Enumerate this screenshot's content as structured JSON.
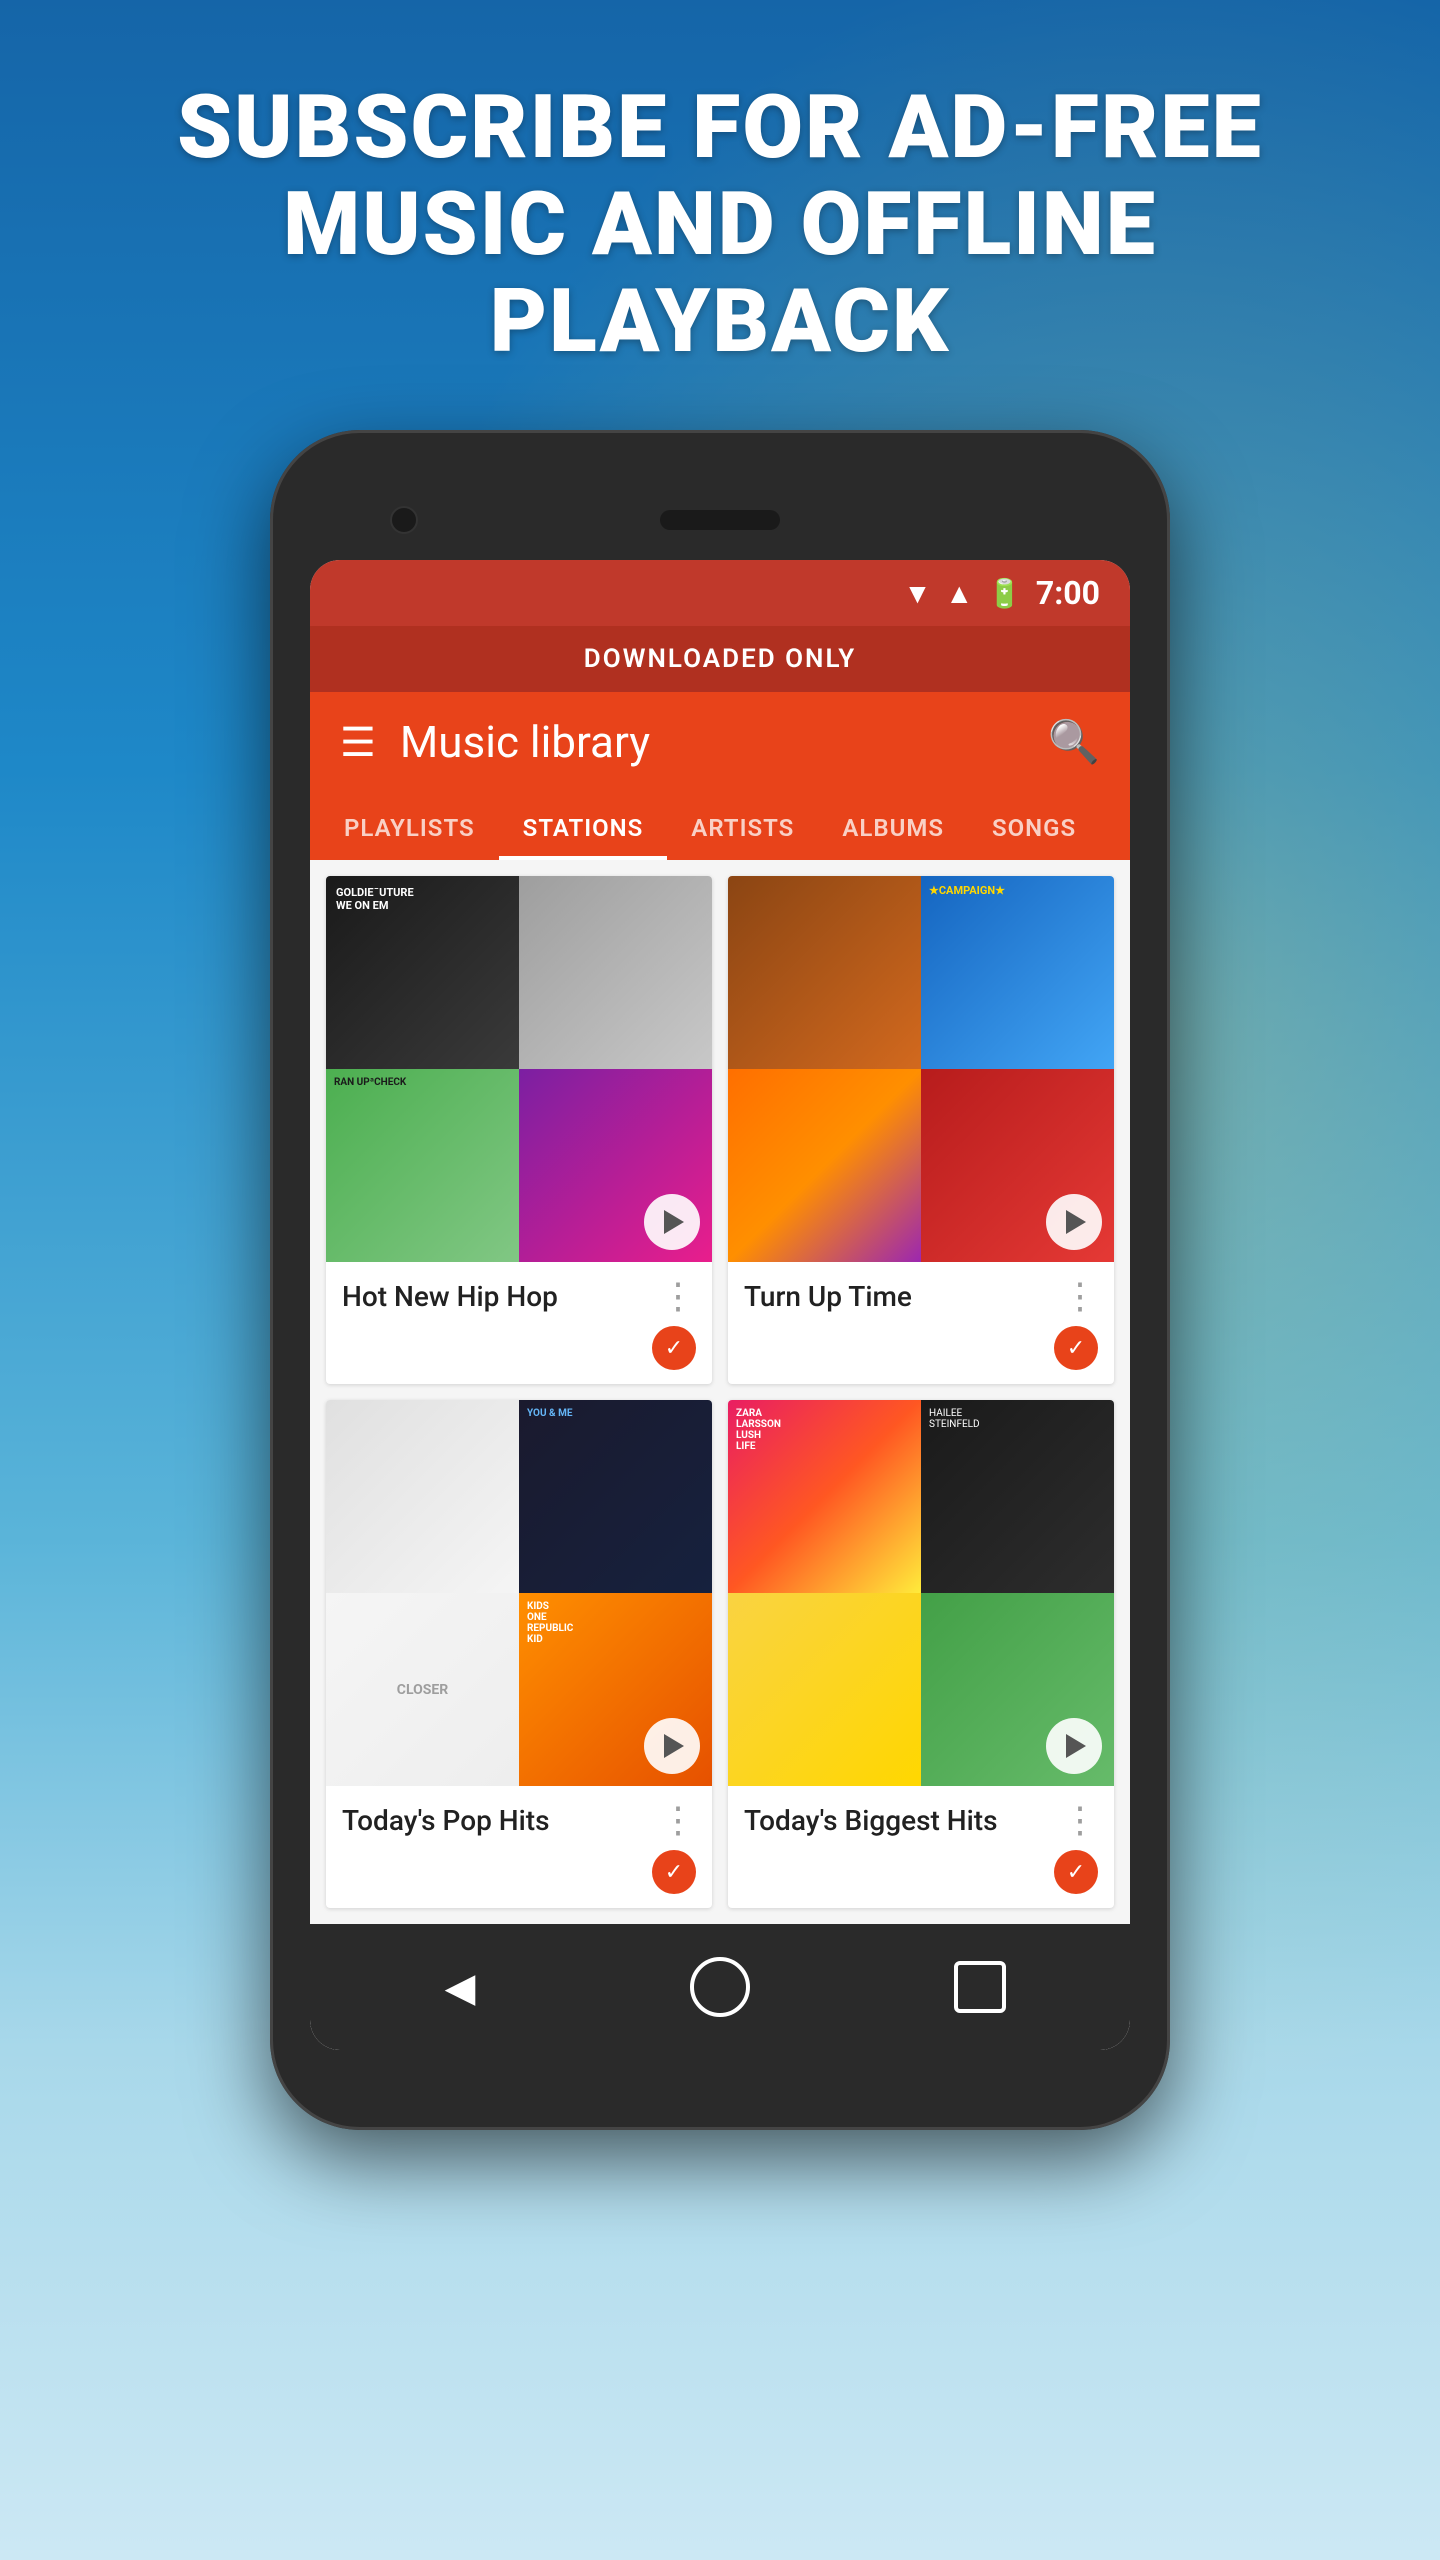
{
  "subscribe_banner": {
    "text": "SUBSCRIBE FOR AD-FREE MUSIC AND OFFLINE PLAYBACK"
  },
  "status_bar": {
    "time": "7:00"
  },
  "download_banner": {
    "text": "DOWNLOADED ONLY"
  },
  "app_header": {
    "title": "Music library"
  },
  "tabs": [
    {
      "label": "PLAYLISTS",
      "active": false
    },
    {
      "label": "STATIONS",
      "active": true
    },
    {
      "label": "ARTISTS",
      "active": false
    },
    {
      "label": "ALBUMS",
      "active": false
    },
    {
      "label": "SONGS",
      "active": false
    }
  ],
  "playlists": [
    {
      "title": "Hot New Hip Hop",
      "more_icon": "⋮",
      "downloaded": true
    },
    {
      "title": "Turn Up Time",
      "more_icon": "⋮",
      "downloaded": true
    },
    {
      "title": "Today's Pop Hits",
      "more_icon": "⋮",
      "downloaded": true
    },
    {
      "title": "Today's Biggest Hits",
      "more_icon": "⋮",
      "downloaded": true
    }
  ],
  "nav": {
    "back": "◀",
    "home": "",
    "apps": ""
  }
}
